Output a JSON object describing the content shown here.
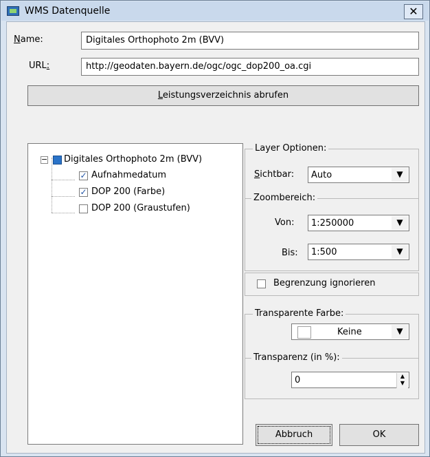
{
  "window": {
    "title": "WMS Datenquelle",
    "close_label": "✕"
  },
  "form": {
    "name_label_underlined": "N",
    "name_label_rest": "ame:",
    "name_value": "Digitales Orthophoto 2m (BVV)",
    "url_label_prefix": "URL",
    "url_label_underlined": ":",
    "url_value": "http://geodaten.bayern.de/ogc/ogc_dop200_oa.cgi",
    "capabilities_button_underlined": "L",
    "capabilities_button_rest": "eistungsverzeichnis abrufen"
  },
  "tree": {
    "root": {
      "label": "Digitales Orthophoto 2m (BVV)",
      "expander": "−"
    },
    "items": [
      {
        "label": "Aufnahmedatum",
        "checked_symbol": "✓"
      },
      {
        "label": "DOP 200 (Farbe)",
        "checked_symbol": "✓"
      },
      {
        "label": "DOP 200 (Graustufen)",
        "checked_symbol": ""
      }
    ]
  },
  "layer_options": {
    "title": "Layer Optionen:",
    "visible_label_underlined": "S",
    "visible_label_rest": "ichtbar:",
    "visible_value": "Auto",
    "zoom_title": "Zoombereich:",
    "from_label": "Von:",
    "from_value": "1:250000",
    "to_label": "Bis:",
    "to_value": "1:500",
    "combo_arrow": "▼"
  },
  "boundary": {
    "label": "Begrenzung ignorieren"
  },
  "transparency": {
    "color_title": "Transparente Farbe:",
    "color_value": "Keine",
    "percent_title": "Transparenz (in %):",
    "percent_value": "0",
    "spin_up": "▲",
    "spin_down": "▼"
  },
  "buttons": {
    "cancel": "Abbruch",
    "ok": "OK"
  }
}
